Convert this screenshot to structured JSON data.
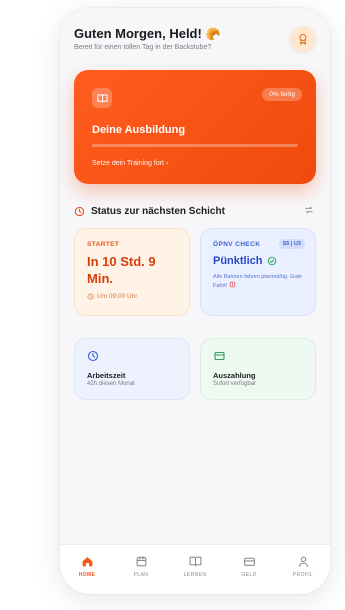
{
  "header": {
    "greeting": "Guten Morgen, Held!",
    "subgreeting": "Bereit für einen tollen Tag in der Backstube?"
  },
  "training": {
    "progress_label": "0% fertig",
    "progress_value": 0,
    "title": "Deine Ausbildung",
    "continue_label": "Setze dein Training fort ›"
  },
  "status": {
    "title": "Status zur nächsten Schicht"
  },
  "start_card": {
    "label": "STARTET",
    "value": "In 10 Std. 9 Min.",
    "time": "Um 09:00 Uhr"
  },
  "oepnv_card": {
    "label": "ÖPNV CHECK",
    "lines": "S5 | U3",
    "value": "Pünktlich",
    "description": "Alle Bahnen fahren planmäßig. Gute Fahrt!"
  },
  "work_card": {
    "title": "Arbeitszeit",
    "subtitle": "42h diesen Monat"
  },
  "payout_card": {
    "title": "Auszahlung",
    "subtitle": "Sofort verfügbar"
  },
  "tabs": [
    {
      "label": "HOME",
      "icon": "home-icon",
      "active": true
    },
    {
      "label": "PLAN",
      "icon": "calendar-icon",
      "active": false
    },
    {
      "label": "LERNEN",
      "icon": "book-icon",
      "active": false
    },
    {
      "label": "GELD",
      "icon": "wallet-icon",
      "active": false
    },
    {
      "label": "PROFIL",
      "icon": "user-icon",
      "active": false
    }
  ],
  "colors": {
    "accent": "#f15a1c",
    "start_text": "#d63e0a",
    "oepnv_text": "#2749c4",
    "card_blue": "#eef2ff",
    "card_green": "#edf9f1"
  }
}
